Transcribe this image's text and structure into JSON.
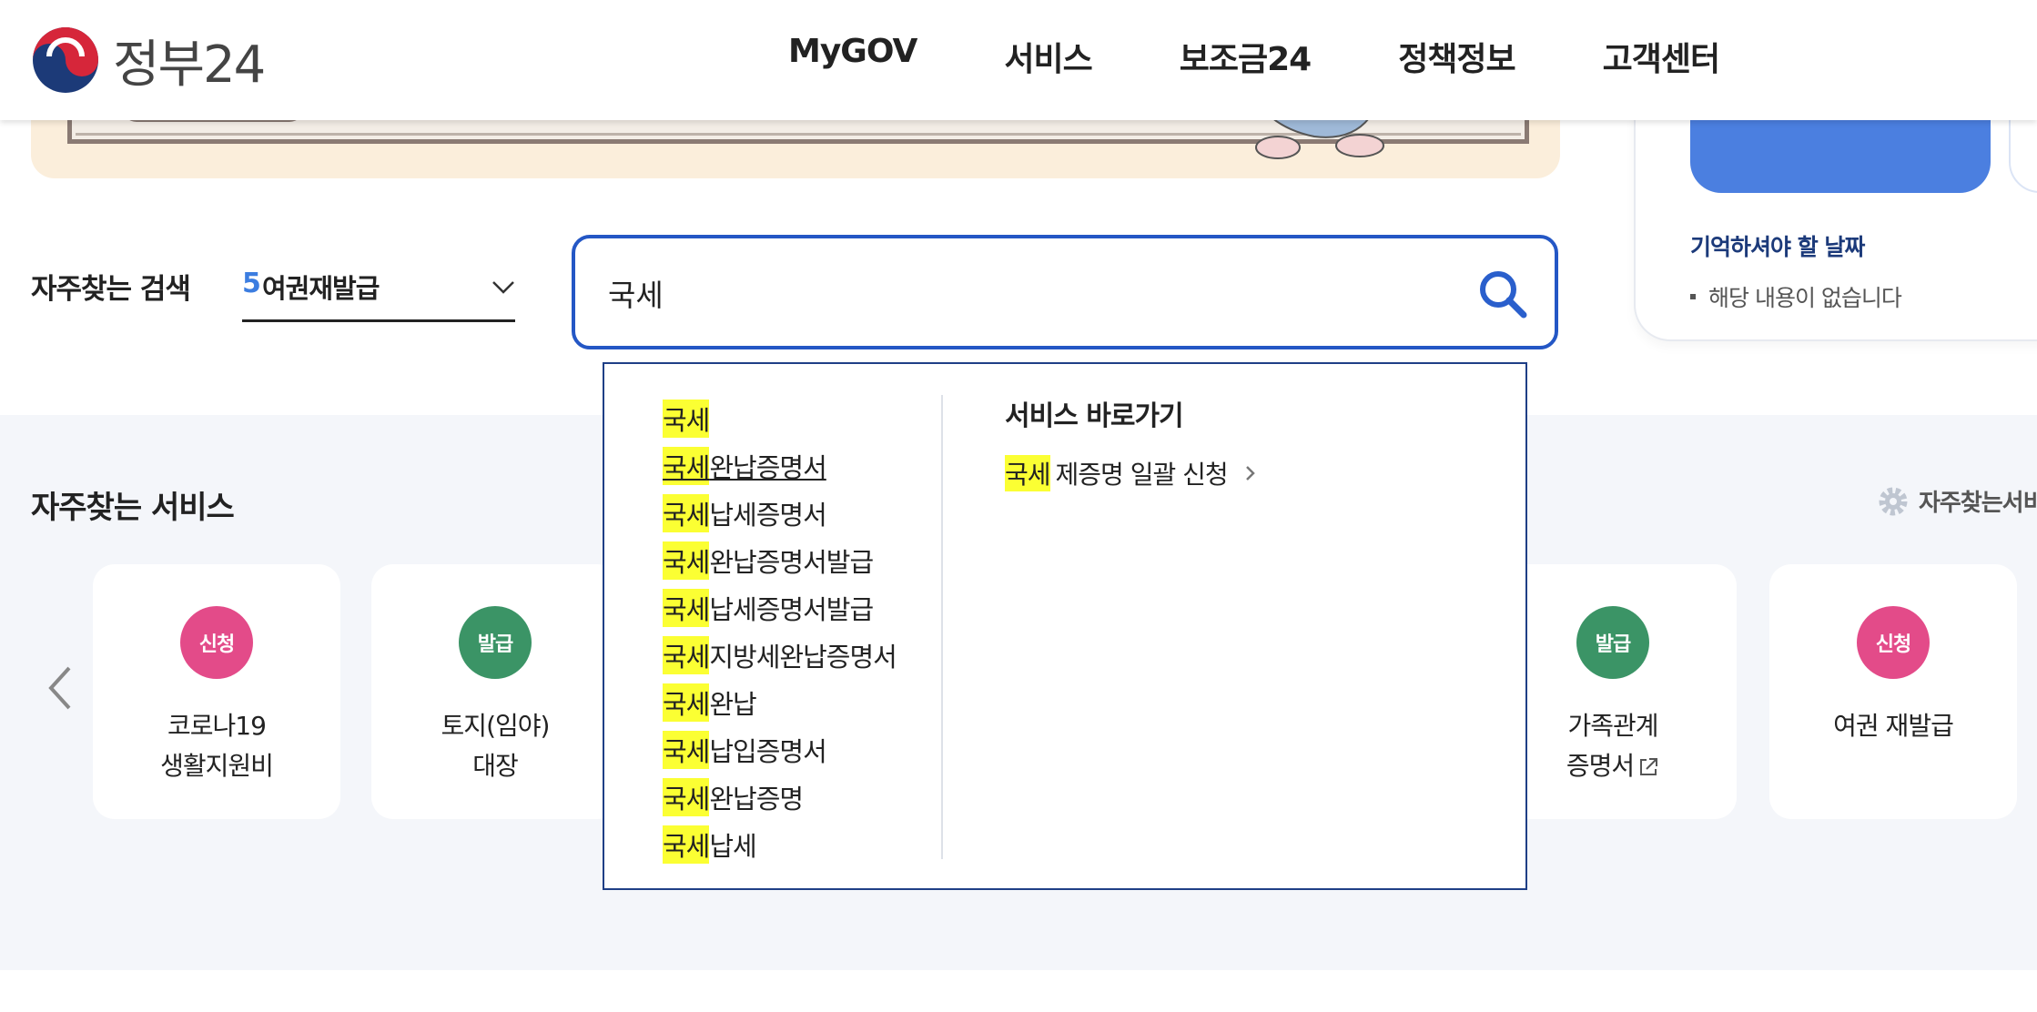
{
  "header": {
    "logo_text": "정부24",
    "nav": [
      "MyGOV",
      "서비스",
      "보조금24",
      "정책정보",
      "고객센터"
    ]
  },
  "right_panel": {
    "remember_title": "기억하셔야 할 날짜",
    "remember_empty": "해당 내용이 없습니다"
  },
  "search": {
    "frequent_label": "자주찾는 검색",
    "rank_number": "5",
    "rank_keyword": "여권재발급",
    "query": "국세"
  },
  "autocomplete": {
    "suggestions": [
      {
        "highlight": "국세",
        "rest": ""
      },
      {
        "highlight": "국세",
        "rest": "완납증명서"
      },
      {
        "highlight": "국세",
        "rest": "납세증명서"
      },
      {
        "highlight": "국세",
        "rest": "완납증명서발급"
      },
      {
        "highlight": "국세",
        "rest": "납세증명서발급"
      },
      {
        "highlight": "국세",
        "rest": "지방세완납증명서"
      },
      {
        "highlight": "국세",
        "rest": "완납"
      },
      {
        "highlight": "국세",
        "rest": "납입증명서"
      },
      {
        "highlight": "국세",
        "rest": "완납증명"
      },
      {
        "highlight": "국세",
        "rest": "납세"
      }
    ],
    "shortcut_title": "서비스 바로가기",
    "shortcut_highlight": "국세",
    "shortcut_rest": "제증명 일괄 신청"
  },
  "services": {
    "title": "자주찾는 서비스",
    "settings_label": "자주찾는서비",
    "cards": [
      {
        "badge": "신청",
        "type": "apply",
        "line1": "코로나19",
        "line2": "생활지원비"
      },
      {
        "badge": "발급",
        "type": "issue",
        "line1": "토지(임야)",
        "line2": "대장"
      },
      {
        "badge": "발급",
        "type": "issue",
        "line1": "가족관계",
        "line2": "증명서"
      },
      {
        "badge": "신청",
        "type": "apply",
        "line1": "여권 재발급",
        "line2": ""
      }
    ]
  },
  "colors": {
    "brand_blue": "#2457c5",
    "highlight": "#fbff33",
    "badge_apply": "#e34b89",
    "badge_issue": "#3b9466"
  },
  "icons": [
    "taegeuk-logo-icon",
    "search-icon",
    "chevron-down-icon",
    "chevron-right-icon",
    "gear-icon",
    "chevron-left-icon",
    "external-link-icon"
  ]
}
